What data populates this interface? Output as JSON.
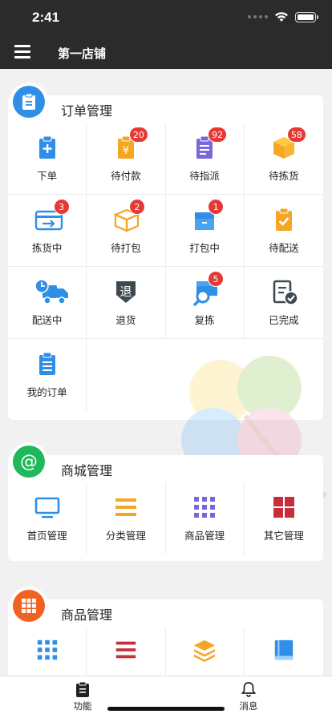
{
  "status_bar": {
    "time": "2:41"
  },
  "nav": {
    "title": "第一店铺"
  },
  "sections": {
    "orders": {
      "title": "订单管理",
      "items": [
        {
          "label": "下单",
          "badge": ""
        },
        {
          "label": "待付款",
          "badge": "20"
        },
        {
          "label": "待指派",
          "badge": "92"
        },
        {
          "label": "待拣货",
          "badge": "58"
        },
        {
          "label": "拣货中",
          "badge": "3"
        },
        {
          "label": "待打包",
          "badge": "2"
        },
        {
          "label": "打包中",
          "badge": "1"
        },
        {
          "label": "待配送",
          "badge": ""
        },
        {
          "label": "配送中",
          "badge": ""
        },
        {
          "label": "退货",
          "badge": ""
        },
        {
          "label": "复拣",
          "badge": "5"
        },
        {
          "label": "已完成",
          "badge": ""
        },
        {
          "label": "我的订单",
          "badge": ""
        }
      ]
    },
    "mall": {
      "title": "商城管理",
      "items": [
        {
          "label": "首页管理"
        },
        {
          "label": "分类管理"
        },
        {
          "label": "商品管理"
        },
        {
          "label": "其它管理"
        }
      ]
    },
    "goods": {
      "title": "商品管理"
    }
  },
  "icons": {
    "order_section": "clipboard-icon",
    "mall_section": "at-sign-icon",
    "goods_section": "grid-icon"
  },
  "colors": {
    "blue": "#2f8fe6",
    "orange": "#f5a623",
    "purple": "#7b68d8",
    "green": "#1fb85b",
    "red": "#c62f3a",
    "section_orange": "#f0621f"
  },
  "tabbar": {
    "function_label": "功能",
    "messages_label": "消息"
  }
}
